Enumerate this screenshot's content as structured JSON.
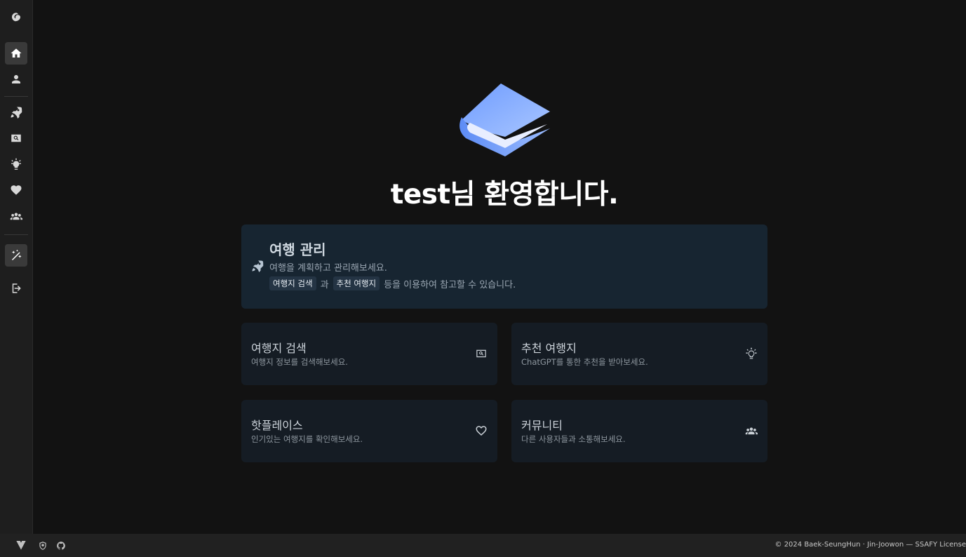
{
  "sidebar": {
    "items": [
      {
        "name": "app-logo-icon"
      },
      {
        "name": "home-icon",
        "active": true
      },
      {
        "name": "user-icon"
      },
      {
        "name": "rocket-icon"
      },
      {
        "name": "search-box-icon"
      },
      {
        "name": "lightbulb-icon"
      },
      {
        "name": "heart-icon"
      },
      {
        "name": "group-icon"
      },
      {
        "name": "magic-wand-icon",
        "active": true
      },
      {
        "name": "logout-icon"
      }
    ]
  },
  "hero": {
    "welcome": "test님 환영합니다.",
    "logo_colors": [
      "#8fb4ff",
      "#5a8ff0",
      "#e6ecff"
    ]
  },
  "main_card": {
    "title": "여행 관리",
    "description": "여행을 계획하고 관리해보세요.",
    "chip1": "여행지 검색",
    "connector": "과",
    "chip2": "추천 여행지",
    "suffix": "등을 이용하여 참고할 수 있습니다."
  },
  "cards": [
    {
      "title": "여행지 검색",
      "subtitle": "여행지 정보를 검색해보세요.",
      "icon": "search-box-icon"
    },
    {
      "title": "추천 여행지",
      "subtitle": "ChatGPT를 통한 추천을 받아보세요.",
      "icon": "lightbulb-icon"
    },
    {
      "title": "핫플레이스",
      "subtitle": "인기있는 여행지를 확인해보세요.",
      "icon": "heart-outline-icon"
    },
    {
      "title": "커뮤니티",
      "subtitle": "다른 사용자들과 소통해보세요.",
      "icon": "group-icon"
    }
  ],
  "footer": {
    "copyright": "© 2024 Baek-SeungHun · Jin-Joowon — SSAFY License",
    "icons": [
      "vuetify-icon",
      "shield-icon",
      "github-icon"
    ]
  },
  "colors": {
    "background": "#121212",
    "rail": "#1e1e1e",
    "main_card": "#172531",
    "card": "#151c24"
  }
}
